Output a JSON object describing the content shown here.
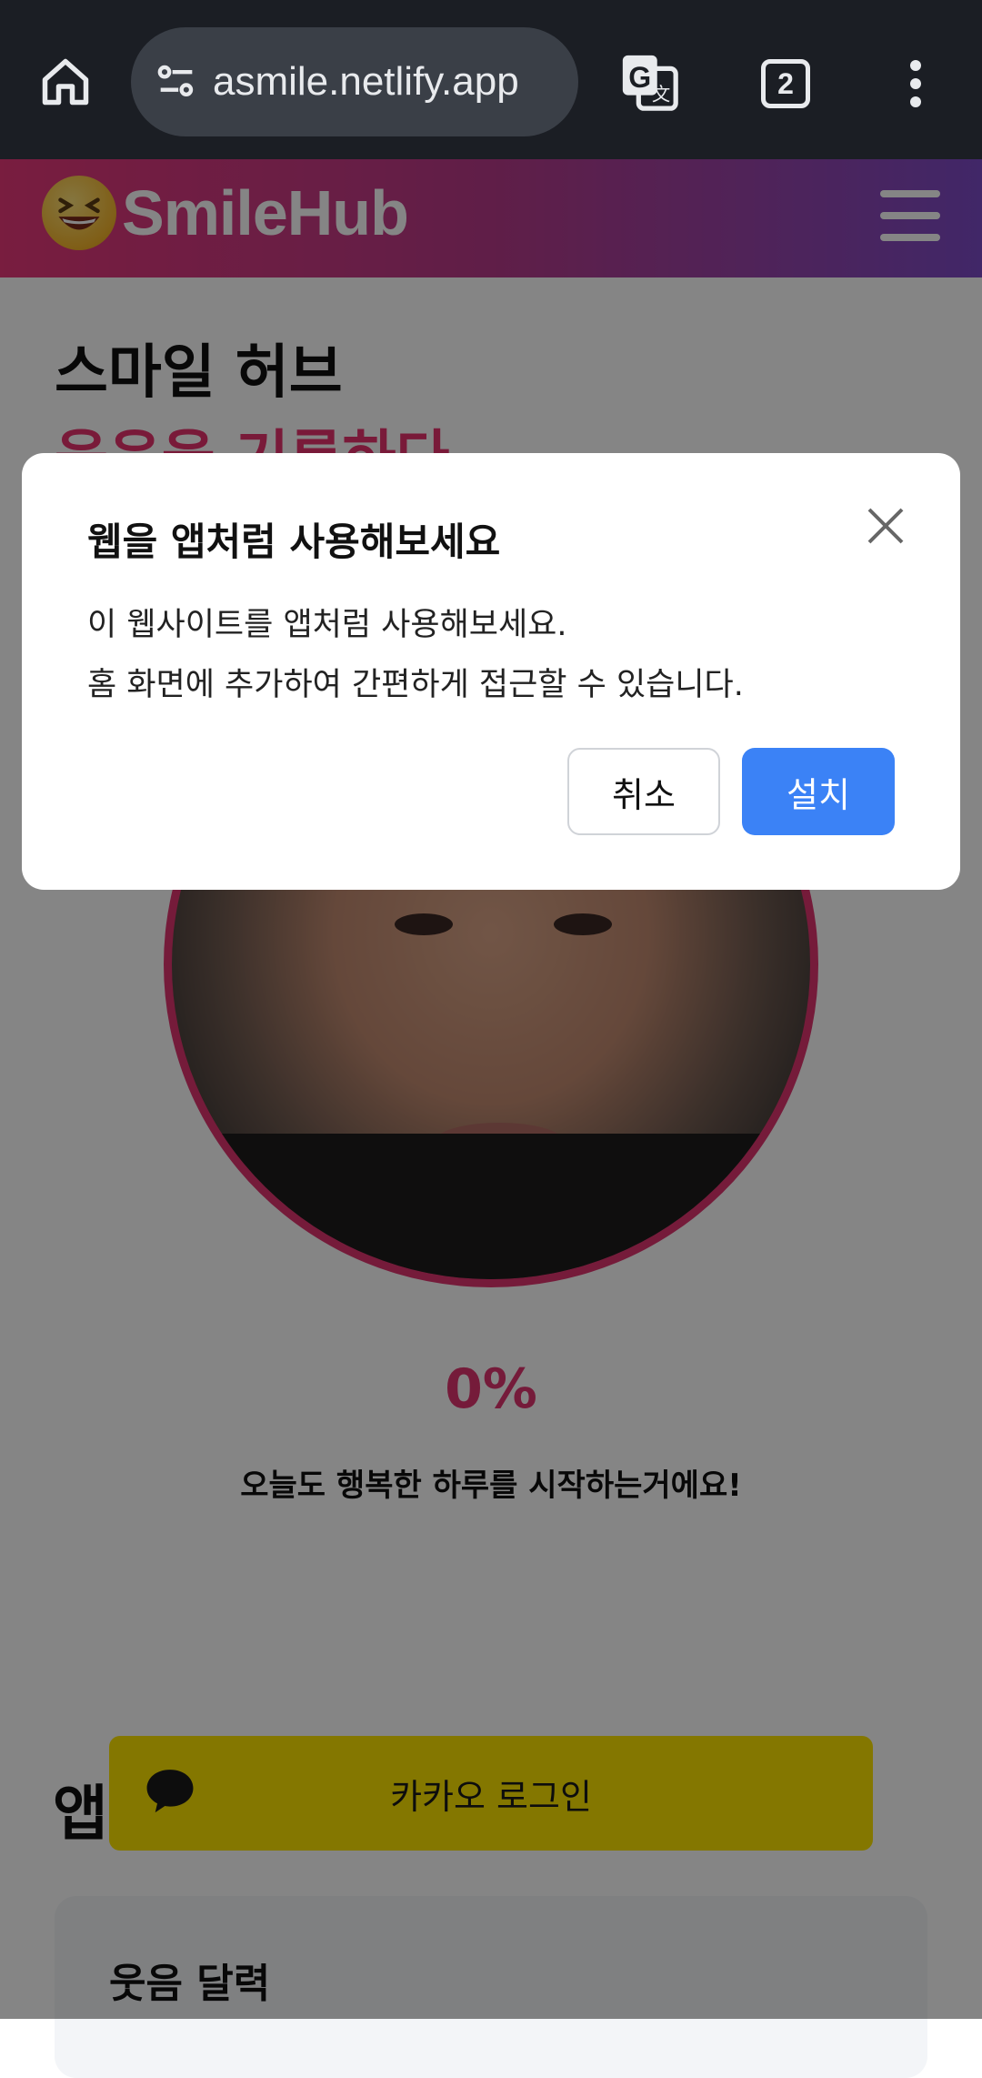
{
  "browser": {
    "url": "asmile.netlify.app",
    "tab_count": "2",
    "icons": [
      "home-icon",
      "site-settings-icon",
      "translate-icon",
      "tabs-icon",
      "more-vert-icon"
    ]
  },
  "site": {
    "logo_text": "SmileHub",
    "logo_emoji": "😆",
    "accent": "#e0356f"
  },
  "hero": {
    "title": "스마일 허브",
    "subtitle": "웃음을 기록하다"
  },
  "progress": {
    "percent_label": "0%",
    "message": "오늘도 행복한 하루를 시작하는거에요!"
  },
  "app_section": {
    "heading_partial": "앱"
  },
  "kakao": {
    "label": "카카오 로그인",
    "color": "#fee500"
  },
  "calendar_card": {
    "title": "웃음 달력"
  },
  "install_dialog": {
    "title": "웹을 앱처럼 사용해보세요",
    "line1": "이 웹사이트를 앱처럼 사용해보세요.",
    "line2": "홈 화면에 추가하여 간편하게 접근할 수 있습니다.",
    "cancel_label": "취소",
    "install_label": "설치",
    "install_color": "#3b82f6"
  }
}
